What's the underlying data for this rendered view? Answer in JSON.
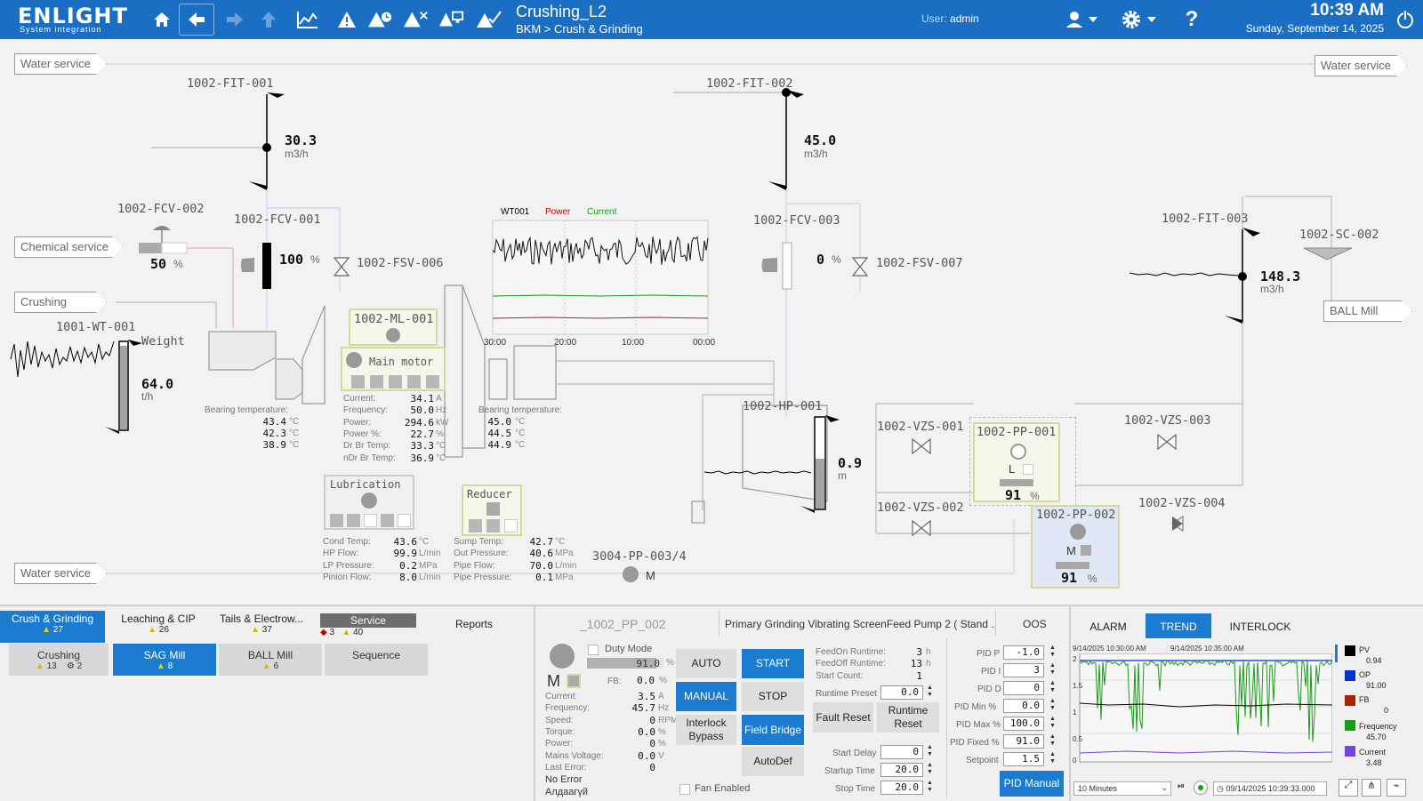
{
  "header": {
    "logo": "ENLIGHT",
    "logo_sub": "System integration",
    "title": "Crushing_L2",
    "breadcrumb": "BKM > Crush & Grinding",
    "user_label": "User:",
    "user_name": "admin",
    "time": "10:39 AM",
    "date": "Sunday, September 14, 2025",
    "accent": "#1a6fc4"
  },
  "services": {
    "water_tl": "Water service",
    "water_tr": "Water service",
    "water_bl": "Water service",
    "chemical": "Chemical service",
    "crushing": "Crushing",
    "ball_mill": "BALL Mill"
  },
  "instruments": {
    "fit001": {
      "tag": "1002-FIT-001",
      "value": "30.3",
      "unit": "m3/h"
    },
    "fit002": {
      "tag": "1002-FIT-002",
      "value": "45.0",
      "unit": "m3/h"
    },
    "fit003": {
      "tag": "1002-FIT-003",
      "value": "148.3",
      "unit": "m3/h"
    },
    "fcv001": {
      "tag": "1002-FCV-001",
      "value": "100",
      "unit": "%"
    },
    "fcv002": {
      "tag": "1002-FCV-002",
      "value": "50",
      "unit": "%"
    },
    "fcv003": {
      "tag": "1002-FCV-003",
      "value": "0",
      "unit": "%"
    },
    "fsv006": "1002-FSV-006",
    "fsv007": "1002-FSV-007",
    "sc002": "1002-SC-002",
    "wt001": {
      "tag": "1001-WT-001",
      "label": "Weight",
      "value": "64.0",
      "unit": "t/h"
    },
    "hp001": {
      "tag": "1002-HP-001",
      "value": "0.9",
      "unit": "m"
    },
    "vzs001": "1002-VZS-001",
    "vzs002": "1002-VZS-002",
    "vzs003": "1002-VZS-003",
    "vzs004": "1002-VZS-004",
    "pp001": {
      "tag": "1002-PP-001",
      "mode": "L",
      "value": "91",
      "unit": "%"
    },
    "pp002": {
      "tag": "1002-PP-002",
      "mode": "M",
      "value": "91",
      "unit": "%"
    },
    "pp003": {
      "tag": "3004-PP-003/4",
      "mode": "M"
    },
    "ml001": "1002-ML-001",
    "main_motor": "Main motor",
    "lubrication": "Lubrication",
    "reducer": "Reducer"
  },
  "trend_mini": {
    "legend": [
      "WT001",
      "Power",
      "Current"
    ],
    "legend_colors": [
      "#000000",
      "#cc0000",
      "#00aa00"
    ],
    "xticks": [
      "30:00",
      "20:00",
      "10:00",
      "00:00"
    ]
  },
  "bearing_left": {
    "label": "Bearing temperature:",
    "values": [
      "43.4",
      "42.3",
      "38.9"
    ],
    "unit": "°C"
  },
  "bearing_right": {
    "label": "Bearing temperature:",
    "values": [
      "45.0",
      "44.5",
      "44.9"
    ],
    "unit": "°C"
  },
  "motor_stats": [
    {
      "label": "Current:",
      "value": "34.1",
      "unit": "A"
    },
    {
      "label": "Frequency:",
      "value": "50.0",
      "unit": "Hz"
    },
    {
      "label": "Power:",
      "value": "294.6",
      "unit": "kW"
    },
    {
      "label": "Power %:",
      "value": "22.7",
      "unit": "%"
    },
    {
      "label": "Dr Br Temp:",
      "value": "33.3",
      "unit": "°C"
    },
    {
      "label": "nDr Br Temp:",
      "value": "36.9",
      "unit": "°C"
    }
  ],
  "lube_stats": [
    {
      "label": "Cond Temp:",
      "value": "43.6",
      "unit": "°C"
    },
    {
      "label": "HP Flow:",
      "value": "99.9",
      "unit": "L/min"
    },
    {
      "label": "LP Pressure:",
      "value": "0.2",
      "unit": "MPa"
    },
    {
      "label": "Pinion Flow:",
      "value": "8.0",
      "unit": "L/min"
    }
  ],
  "reducer_stats": [
    {
      "label": "Sump Temp:",
      "value": "42.7",
      "unit": "°C"
    },
    {
      "label": "Out Pressure:",
      "value": "40.6",
      "unit": "MPa"
    },
    {
      "label": "Pipe Flow:",
      "value": "70.0",
      "unit": "L/min"
    },
    {
      "label": "Pipe Pressure:",
      "value": "0.1",
      "unit": "MPa"
    }
  ],
  "nav": {
    "tabs": [
      {
        "label": "Crush & Grinding",
        "warn": "27"
      },
      {
        "label": "Leaching & CIP",
        "warn": "26"
      },
      {
        "label": "Tails & Electrow...",
        "warn": "37"
      },
      {
        "label": "Service",
        "alarm": "3",
        "warn": "40"
      },
      {
        "label": "Reports"
      }
    ],
    "subtabs": [
      {
        "label": "Crushing",
        "warn": "13",
        "other": "2"
      },
      {
        "label": "SAG Mill",
        "warn": "8"
      },
      {
        "label": "BALL Mill",
        "warn": "6"
      },
      {
        "label": "Sequence"
      }
    ]
  },
  "faceplate": {
    "tag": "_1002_PP_002",
    "description": "Primary Grinding Vibrating ScreenFeed Pump 2 ( Stand ...",
    "oos": "OOS",
    "duty_mode": "Duty Mode",
    "mode_letter": "M",
    "setpoint_bar": "91.0",
    "setpoint_bar_pct": 91,
    "setpoint_unit": "%",
    "fb_label": "FB:",
    "fb_value": "0.0",
    "fb_unit": "%",
    "stats": [
      {
        "label": "Current:",
        "value": "3.5",
        "unit": "A"
      },
      {
        "label": "Frequency:",
        "value": "45.7",
        "unit": "Hz"
      },
      {
        "label": "Speed:",
        "value": "0",
        "unit": "RPM"
      },
      {
        "label": "Torque:",
        "value": "0.0",
        "unit": "%"
      },
      {
        "label": "Power:",
        "value": "0",
        "unit": "%"
      },
      {
        "label": "Mains Voltage:",
        "value": "0.0",
        "unit": "V"
      },
      {
        "label": "Last Error:",
        "value": "0",
        "unit": ""
      }
    ],
    "no_error": "No Error",
    "error_local": "Алдаагүй",
    "buttons": {
      "auto": "AUTO",
      "start": "START",
      "manual": "MANUAL",
      "stop": "STOP",
      "interlock": "Interlock Bypass",
      "field": "Field Bridge",
      "autodef": "AutoDef",
      "fault_reset": "Fault Reset",
      "runtime_reset": "Runtime Reset",
      "pid_manual": "PID Manual"
    },
    "fan_enabled": "Fan Enabled",
    "runtime": [
      {
        "label": "FeedOn Runtime:",
        "value": "3",
        "unit": "h"
      },
      {
        "label": "FeedOff Runtime:",
        "value": "13",
        "unit": "h"
      },
      {
        "label": "Start Count:",
        "value": "1",
        "unit": ""
      }
    ],
    "runtime_preset": {
      "label": "Runtime Preset",
      "value": "0.0"
    },
    "timers": [
      {
        "label": "Start Delay",
        "value": "0"
      },
      {
        "label": "Startup Time",
        "value": "20.0"
      },
      {
        "label": "Stop Time",
        "value": "20.0"
      }
    ],
    "pid": [
      {
        "label": "PID P",
        "value": "-1.0"
      },
      {
        "label": "PID I",
        "value": "3"
      },
      {
        "label": "PID D",
        "value": "0"
      },
      {
        "label": "PID Min %",
        "value": "0.0"
      },
      {
        "label": "PID Max %",
        "value": "100.0"
      },
      {
        "label": "PID Fixed %",
        "value": "91.0"
      },
      {
        "label": "Setpoint",
        "value": "1.5"
      }
    ]
  },
  "trend_panel": {
    "tabs": [
      "ALARM",
      "TREND",
      "INTERLOCK"
    ],
    "active_tab": "TREND",
    "time_left": "9/14/2025 10:30:00 AM",
    "time_mid": "9/14/2025 10:35:00 AM",
    "yticks": [
      "2",
      "1.5",
      "1",
      "0.5",
      "0"
    ],
    "range": "10 Minutes",
    "timestamp": "09/14/2025 10:39:33.000",
    "legend": [
      {
        "name": "PV",
        "value": "0.94",
        "color": "#000000"
      },
      {
        "name": "OP",
        "value": "91.00",
        "color": "#0033cc"
      },
      {
        "name": "FB",
        "value": "0",
        "color": "#aa2200"
      },
      {
        "name": "Frequency",
        "value": "45.70",
        "color": "#1a9a1a"
      },
      {
        "name": "Current",
        "value": "3.48",
        "color": "#7744dd"
      }
    ]
  }
}
